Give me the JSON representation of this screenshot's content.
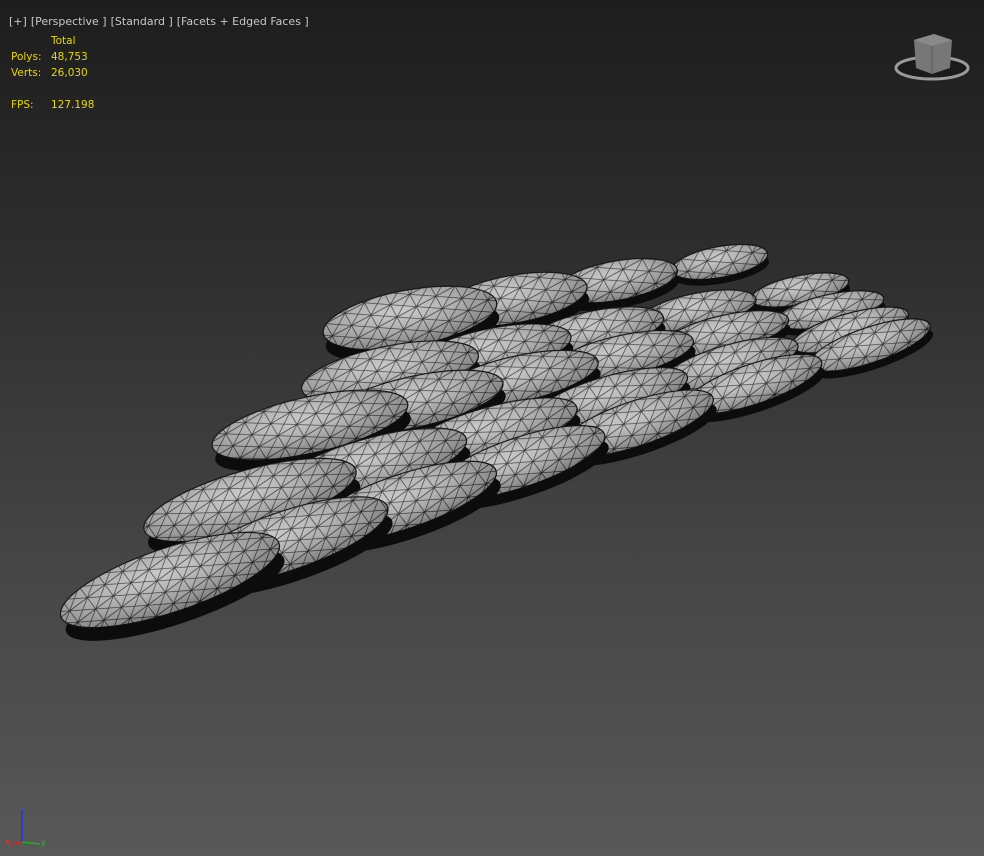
{
  "viewport": {
    "labels": [
      "[+]",
      "[Perspective ]",
      "[Standard ]",
      "[Facets + Edged Faces ]"
    ],
    "stats": {
      "header": "Total",
      "rows": [
        {
          "key": "Polys:",
          "value": "48,753"
        },
        {
          "key": "Verts:",
          "value": "26,030"
        }
      ],
      "fps_key": "FPS:",
      "fps_value": "127.198"
    },
    "text_color": "#e6d800",
    "axis": {
      "x": "x",
      "y": "y",
      "z": "z"
    }
  }
}
